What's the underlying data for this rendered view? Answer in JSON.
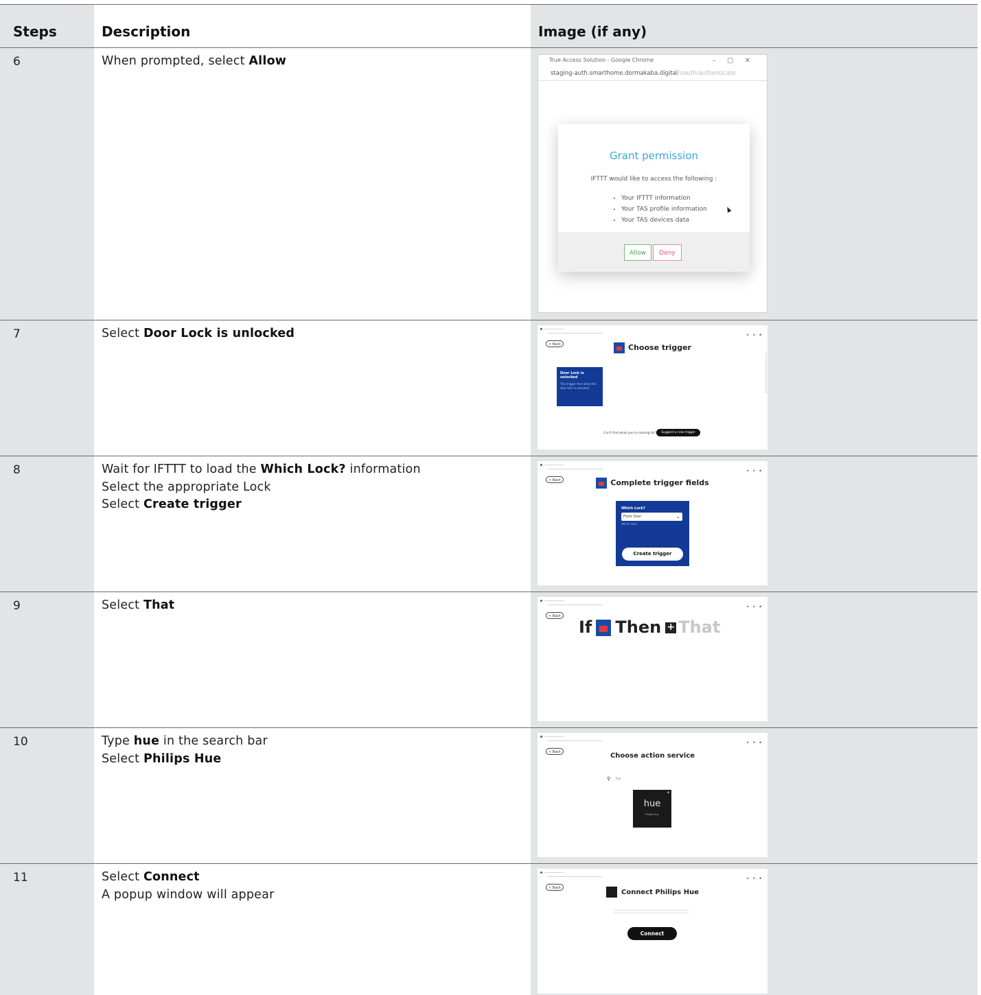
{
  "headers": {
    "steps": "Steps",
    "description": "Description",
    "image": "Image (if any)"
  },
  "rows": [
    {
      "step": "6",
      "lines": [
        [
          {
            "t": "When prompted, select "
          },
          {
            "t": "Allow",
            "b": true
          }
        ]
      ],
      "screenshot": {
        "window_title": "True Access Solution - Google Chrome",
        "url_main": "staging-auth.smarthome.dormakaba.digital",
        "url_path": "/oauth/authenticate",
        "heading": "Grant permission",
        "intro": "IFTTT would like to access the following :",
        "permissions": [
          "Your IFTTT information",
          "Your TAS profile information",
          "Your TAS devices data"
        ],
        "allow": "Allow",
        "deny": "Deny"
      }
    },
    {
      "step": "7",
      "lines": [
        [
          {
            "t": "Select "
          },
          {
            "t": "Door Lock is unlocked",
            "b": true
          }
        ]
      ],
      "screenshot": {
        "back": "< Back",
        "title": "Choose trigger",
        "card_title": "Door Lock is unlocked",
        "card_sub": "This trigger fires when the door lock is unlocked",
        "cant_find": "Can't find what you're looking for?",
        "suggest": "Suggest a new trigger"
      }
    },
    {
      "step": "8",
      "lines": [
        [
          {
            "t": "Wait for IFTTT to load the "
          },
          {
            "t": "Which Lock?",
            "b": true
          },
          {
            "t": " information"
          }
        ],
        [
          {
            "t": "Select the appropriate Lock"
          }
        ],
        [
          {
            "t": "Select "
          },
          {
            "t": "Create trigger",
            "b": true
          }
        ]
      ],
      "screenshot": {
        "back": "< Back",
        "title": "Complete trigger fields",
        "field_label": "Which Lock?",
        "field_value": "Front Door",
        "field_hint": "Which lock?",
        "create": "Create trigger"
      }
    },
    {
      "step": "9",
      "lines": [
        [
          {
            "t": "Select "
          },
          {
            "t": "That",
            "b": true
          }
        ]
      ],
      "screenshot": {
        "back": "< Back",
        "if_word": "If",
        "then_word": "Then",
        "that_word": "That"
      }
    },
    {
      "step": "10",
      "lines": [
        [
          {
            "t": "Type "
          },
          {
            "t": "hue",
            "b": true
          },
          {
            "t": " in the search bar"
          }
        ],
        [
          {
            "t": "Select "
          },
          {
            "t": "Philips Hue",
            "b": true
          }
        ]
      ],
      "screenshot": {
        "back": "< Back",
        "title": "Choose action service",
        "search_value": "hue",
        "tile_word": "hue",
        "tile_sub": "Philips Hue"
      }
    },
    {
      "step": "11",
      "lines": [
        [
          {
            "t": "Select "
          },
          {
            "t": "Connect",
            "b": true
          }
        ],
        [
          {
            "t": "A popup window will appear"
          }
        ]
      ],
      "screenshot": {
        "back": "< Back",
        "title": "Connect Philips Hue",
        "connect": "Connect"
      }
    }
  ],
  "colors": {
    "column_shade": "#e3e4e6",
    "rule": "#6b6b6b",
    "grant_blue": "#3aa5d8",
    "allow_green": "#4a9b4f",
    "deny_red": "#d9566b",
    "tas_blue": "#123a96"
  }
}
